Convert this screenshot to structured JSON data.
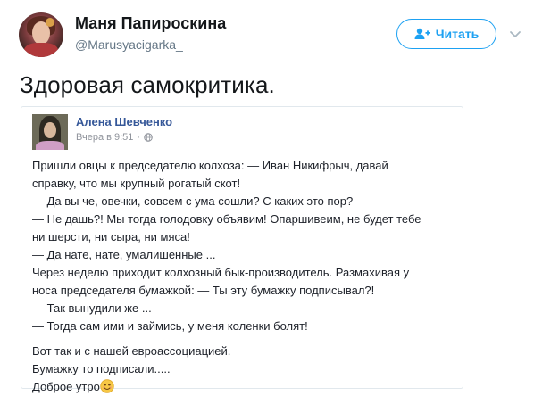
{
  "tweet": {
    "author_name": "Маня Папироскина",
    "author_handle": "@Marusyacigarka_",
    "follow_label": "Читать",
    "text": "Здоровая самокритика."
  },
  "fb_post": {
    "author_name": "Алена Шевченко",
    "timestamp": "Вчера в 9:51",
    "paragraph1": [
      "Пришли овцы к председателю колхоза: — Иван Никифрыч, давай",
      "справку, что мы крупный рогатый скот!",
      "— Да вы че, овечки, совсем с ума сошли? С каких это пор?",
      "— Не дашь?! Мы тогда голодовку объявим! Опаршивеим, не будет тебе",
      "ни шерсти, ни сыра, ни мяса!",
      "— Да нате, нате, умалишенные ...",
      "Через неделю приходит колхозный бык-производитель. Размахивая у",
      "носа председателя бумажкой: — Ты эту бумажку подписывал?!",
      "— Так вынудили же ...",
      "— Тогда сам ими и займись, у меня коленки болят!"
    ],
    "paragraph2": [
      "Вот так и с нашей евроассоциацией.",
      "Бумажку то подписали....."
    ],
    "last_line": "Доброе утро",
    "last_emoji": "smiling-face-emoji"
  },
  "colors": {
    "twitter_blue": "#1da1f2",
    "fb_name_blue": "#365899",
    "muted_gray": "#657786"
  }
}
